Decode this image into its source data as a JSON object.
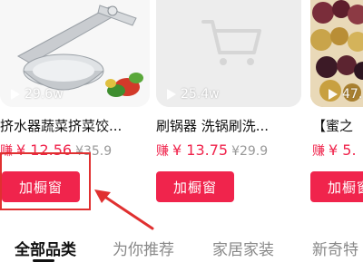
{
  "products": [
    {
      "views": "29.6w",
      "title": "挤水器蔬菜挤菜饺...",
      "earn_label": "赚",
      "price": "¥ 12.56",
      "original_price": "¥35.9",
      "button_label": "加橱窗",
      "thumb_icon": "juicer-press-image"
    },
    {
      "views": "25.4w",
      "title": "刷锅器 洗锅刷洗...",
      "earn_label": "赚",
      "price": "¥ 13.75",
      "original_price": "¥29.9",
      "button_label": "加橱窗",
      "thumb_icon": "cart-placeholder-icon"
    },
    {
      "views": "47.",
      "title": "【蜜之",
      "earn_label": "赚",
      "price": "¥ 5.",
      "original_price": "",
      "button_label": "加橱窗",
      "thumb_icon": "dried-fruit-image"
    }
  ],
  "tabs": [
    {
      "label": "全部品类",
      "active": true
    },
    {
      "label": "为你推荐",
      "active": false
    },
    {
      "label": "家居家装",
      "active": false
    },
    {
      "label": "新奇特",
      "active": false
    }
  ],
  "colors": {
    "accent": "#f0244c",
    "highlight": "#e03030"
  }
}
